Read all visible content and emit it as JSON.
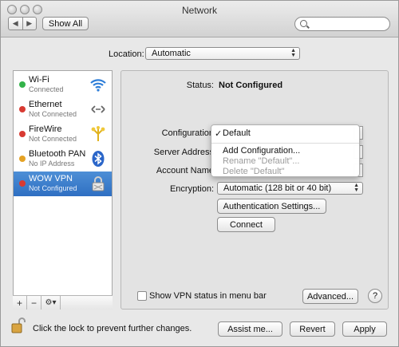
{
  "window": {
    "title": "Network"
  },
  "toolbar": {
    "show_all_label": "Show All",
    "search_placeholder": ""
  },
  "location": {
    "label": "Location:",
    "value": "Automatic"
  },
  "services": [
    {
      "name": "Wi-Fi",
      "status": "Connected",
      "status_color": "#33b249",
      "icon": "wifi-icon"
    },
    {
      "name": "Ethernet",
      "status": "Not Connected",
      "status_color": "#d83a32",
      "icon": "ethernet-icon"
    },
    {
      "name": "FireWire",
      "status": "Not Connected",
      "status_color": "#d83a32",
      "icon": "firewire-icon"
    },
    {
      "name": "Bluetooth PAN",
      "status": "No IP Address",
      "status_color": "#e5a224",
      "icon": "bluetooth-icon"
    },
    {
      "name": "WOW VPN",
      "status": "Not Configured",
      "status_color": "#d83a32",
      "icon": "vpn-lock-icon",
      "selected": true
    }
  ],
  "list_footer": {
    "add": "+",
    "remove": "−",
    "action": "⚙▾"
  },
  "detail": {
    "status_label": "Status:",
    "status_value": "Not Configured",
    "configuration_label": "Configuration",
    "server_address_label": "Server Address",
    "account_name_label": "Account Name",
    "encryption_label": "Encryption:",
    "encryption_value": "Automatic (128 bit or 40 bit)",
    "auth_settings_label": "Authentication Settings...",
    "connect_label": "Connect"
  },
  "configuration_menu": {
    "selected": "Default",
    "check": "✓",
    "items": [
      {
        "label": "Add Configuration...",
        "enabled": true
      },
      {
        "label": "Rename \"Default\"...",
        "enabled": false
      },
      {
        "label": "Delete \"Default\"",
        "enabled": false
      }
    ]
  },
  "options": {
    "show_vpn_status_label": "Show VPN status in menu bar",
    "show_vpn_status_checked": false,
    "advanced_label": "Advanced...",
    "help_label": "?"
  },
  "footer": {
    "lock_text": "Click the lock to prevent further changes.",
    "assist_label": "Assist me...",
    "revert_label": "Revert",
    "apply_label": "Apply"
  },
  "colors": {
    "selection": "#3a7bcc",
    "status_green": "#33b249",
    "status_red": "#d83a32",
    "status_amber": "#e5a224"
  }
}
